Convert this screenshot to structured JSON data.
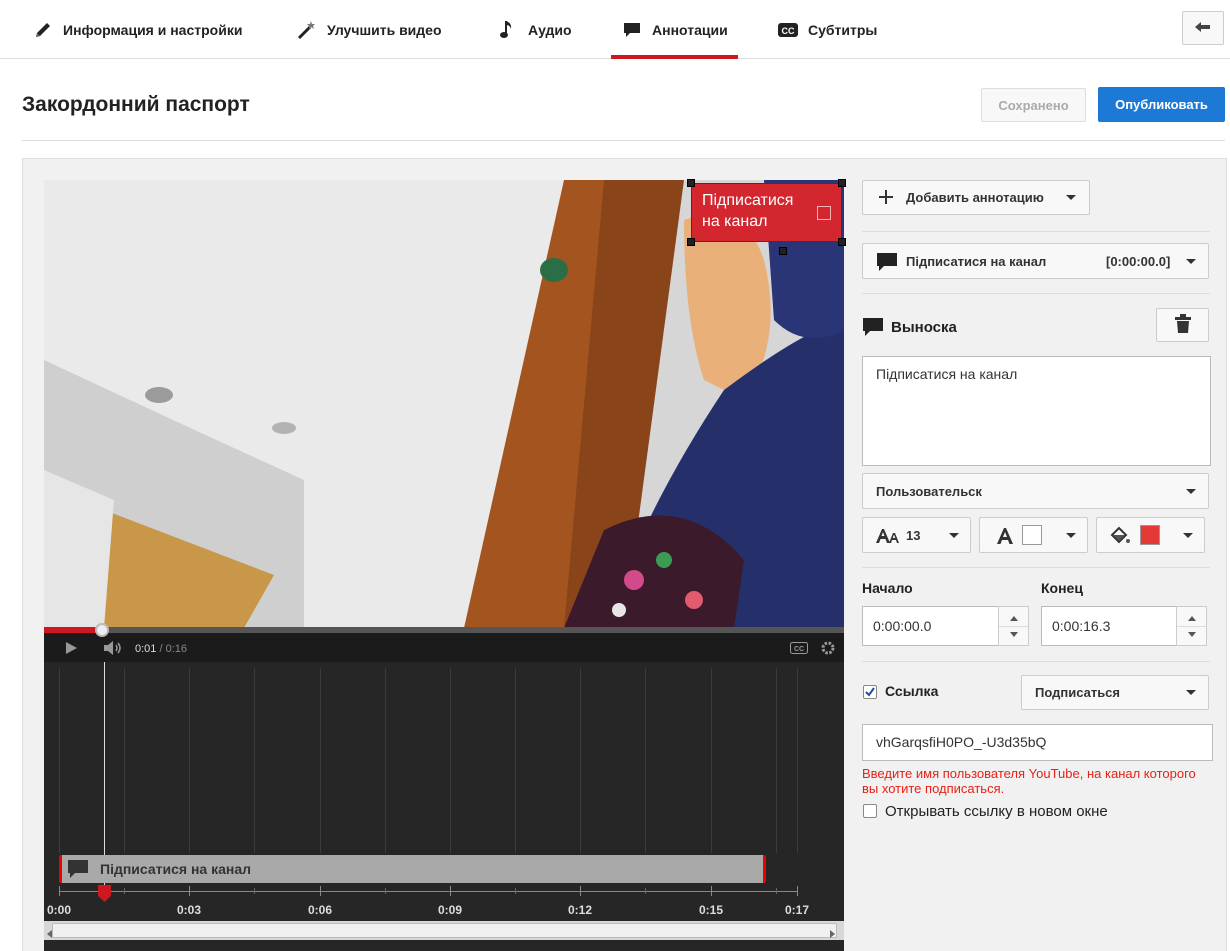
{
  "nav": {
    "tabs": [
      {
        "label": "Информация и настройки",
        "icon": "pencil-icon"
      },
      {
        "label": "Улучшить видео",
        "icon": "magic-wand-icon"
      },
      {
        "label": "Аудио",
        "icon": "music-note-icon"
      },
      {
        "label": "Аннотации",
        "icon": "speech-bubble-icon",
        "active": true
      },
      {
        "label": "Субтитры",
        "icon": "cc-icon"
      }
    ],
    "back_icon": "back-arrow-icon"
  },
  "header": {
    "title": "Закордонний паспорт",
    "saved_label": "Сохранено",
    "publish_label": "Опубликовать"
  },
  "video": {
    "annotation_text": "Підписатися на канал",
    "time_current": "0:01",
    "time_duration": " / 0:16",
    "progress_fraction": 0.07
  },
  "timeline": {
    "track_label": "Підписатися на канал",
    "ruler_labels": [
      "0:00",
      "0:03",
      "0:06",
      "0:09",
      "0:12",
      "0:15",
      "0:17"
    ]
  },
  "panel": {
    "add_annotation_label": "Добавить аннотацию",
    "selected_annotation_label": "Підписатися на канал",
    "selected_annotation_time": "[0:00:00.0]",
    "section_title": "Выноска",
    "text_value": "Підписатися на канал",
    "style_value": "Пользовательск",
    "font_size": "13",
    "text_color": "#ffffff",
    "bg_color": "#e53935",
    "start_label": "Начало",
    "end_label": "Конец",
    "start_value": "0:00:00.0",
    "end_value": "0:00:16.3",
    "link_label": "Ссылка",
    "link_checked": true,
    "link_type_value": "Подписаться",
    "link_value": "vhGarqsfiH0PO_-U3d35bQ",
    "error_text": "Введите имя пользователя YouTube, на канал которого вы хотите подписаться.",
    "new_window_label": "Открывать ссылку в новом окне",
    "new_window_checked": false
  }
}
